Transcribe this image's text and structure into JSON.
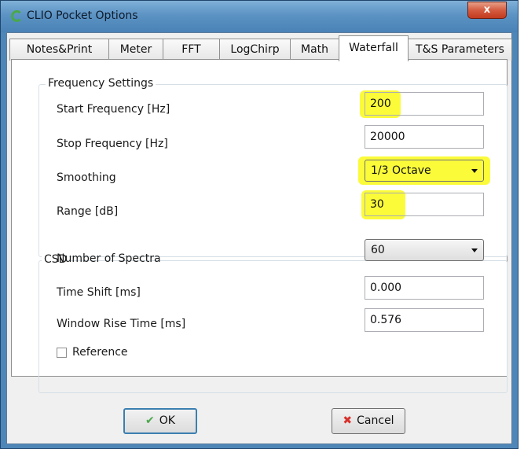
{
  "window": {
    "title": "CLIO Pocket Options",
    "close_label": "x"
  },
  "tabs": [
    {
      "label": "Notes&Print"
    },
    {
      "label": "Meter"
    },
    {
      "label": "FFT"
    },
    {
      "label": "LogChirp"
    },
    {
      "label": "Math"
    },
    {
      "label": "Waterfall",
      "active": true
    },
    {
      "label": "T&S Parameters"
    }
  ],
  "frequency_settings": {
    "title": "Frequency Settings",
    "start_label": "Start Frequency [Hz]",
    "start_value": "200",
    "stop_label": "Stop Frequency [Hz]",
    "stop_value": "20000",
    "smoothing_label": "Smoothing",
    "smoothing_value": "1/3 Octave",
    "range_label": "Range [dB]",
    "range_value": "30"
  },
  "csd": {
    "title": "CSD",
    "spectra_label": "Number of Spectra",
    "spectra_value": "60",
    "timeshift_label": "Time Shift [ms]",
    "timeshift_value": "0.000",
    "rise_label": "Window Rise Time [ms]",
    "rise_value": "0.576",
    "reference_label": "Reference"
  },
  "buttons": {
    "ok_label": "OK",
    "cancel_label": "Cancel"
  },
  "colors": {
    "highlight": "#fbfb3a",
    "ok_icon": "#4aa84a",
    "cancel_icon": "#d8302a"
  }
}
